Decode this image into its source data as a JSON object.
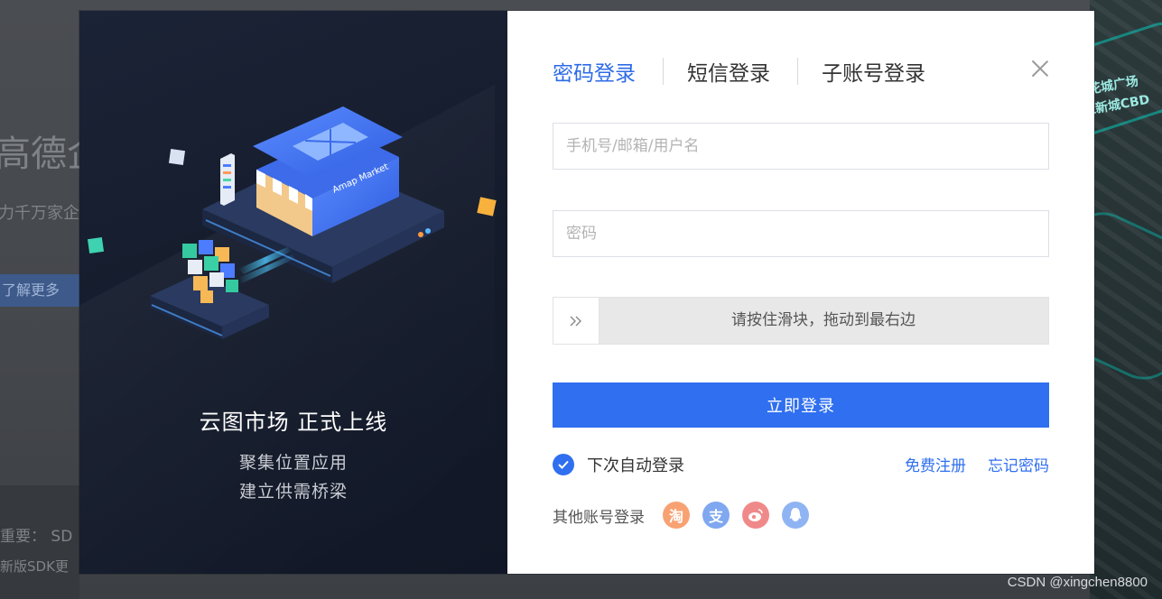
{
  "background": {
    "title_fragment": "高德企",
    "subtitle_fragment": "力千万家企",
    "more_button": "了解更多",
    "note1": "重要： SD",
    "note2": "新版SDK更",
    "map_label1": "花城广场",
    "map_label2": "江新城CBD"
  },
  "promo": {
    "title": "云图市场  正式上线",
    "line1": "聚集位置应用",
    "line2": "建立供需桥梁",
    "illustration_sign": "Amap Market"
  },
  "login": {
    "tabs": [
      {
        "label": "密码登录",
        "active": true
      },
      {
        "label": "短信登录",
        "active": false
      },
      {
        "label": "子账号登录",
        "active": false
      }
    ],
    "close_icon": "close-icon",
    "username_placeholder": "手机号/邮箱/用户名",
    "username_value": "",
    "password_placeholder": "密码",
    "password_value": "",
    "slider_text": "请按住滑块，拖动到最右边",
    "submit_label": "立即登录",
    "remember_label": "下次自动登录",
    "remember_checked": true,
    "register_link": "免费注册",
    "forgot_link": "忘记密码",
    "other_label": "其他账号登录",
    "social": [
      {
        "name": "taobao-icon",
        "glyph": "淘",
        "color": "#f8a273"
      },
      {
        "name": "alipay-icon",
        "glyph": "支",
        "color": "#7fa8f0"
      },
      {
        "name": "weibo-icon",
        "glyph": "",
        "color": "#f08a8a"
      },
      {
        "name": "qq-icon",
        "glyph": "",
        "color": "#8fb4f3"
      }
    ]
  },
  "watermark": "CSDN @xingchen8800",
  "colors": {
    "accent": "#2f6ff0",
    "active_tab": "#2e6be6",
    "promo_bg": "#141b2b"
  }
}
